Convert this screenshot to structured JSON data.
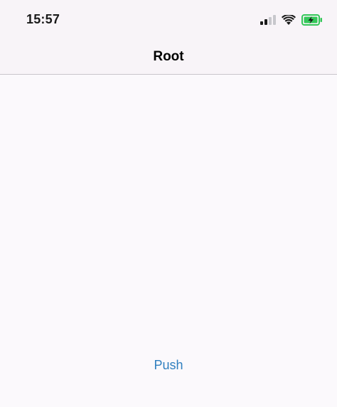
{
  "status_bar": {
    "time": "15:57",
    "icons": [
      "cellular-signal-icon",
      "wifi-icon",
      "battery-charging-icon"
    ]
  },
  "navigation_bar": {
    "title": "Root"
  },
  "main": {
    "push_button_label": "Push"
  },
  "colors": {
    "accent": "#2f7fbf",
    "battery_fill": "#34c759",
    "background": "#fbf9fc"
  }
}
